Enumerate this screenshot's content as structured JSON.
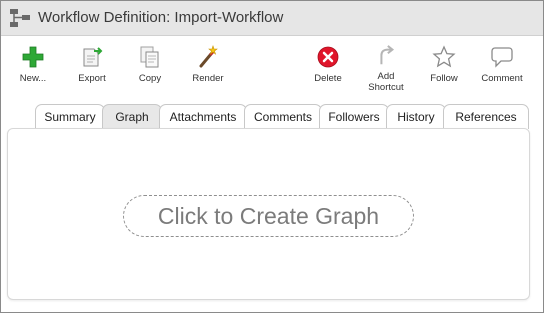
{
  "window": {
    "title": "Workflow Definition: Import-Workflow"
  },
  "toolbar": {
    "new_label": "New...",
    "export_label": "Export",
    "copy_label": "Copy",
    "render_label": "Render",
    "delete_label": "Delete",
    "add_shortcut_label": "Add\nShortcut",
    "follow_label": "Follow",
    "comment_label": "Comment"
  },
  "tabs": [
    {
      "label": "Summary"
    },
    {
      "label": "Graph"
    },
    {
      "label": "Attachments"
    },
    {
      "label": "Comments"
    },
    {
      "label": "Followers"
    },
    {
      "label": "History"
    },
    {
      "label": "References"
    }
  ],
  "graph_panel": {
    "create_graph_label": "Click to Create Graph"
  }
}
